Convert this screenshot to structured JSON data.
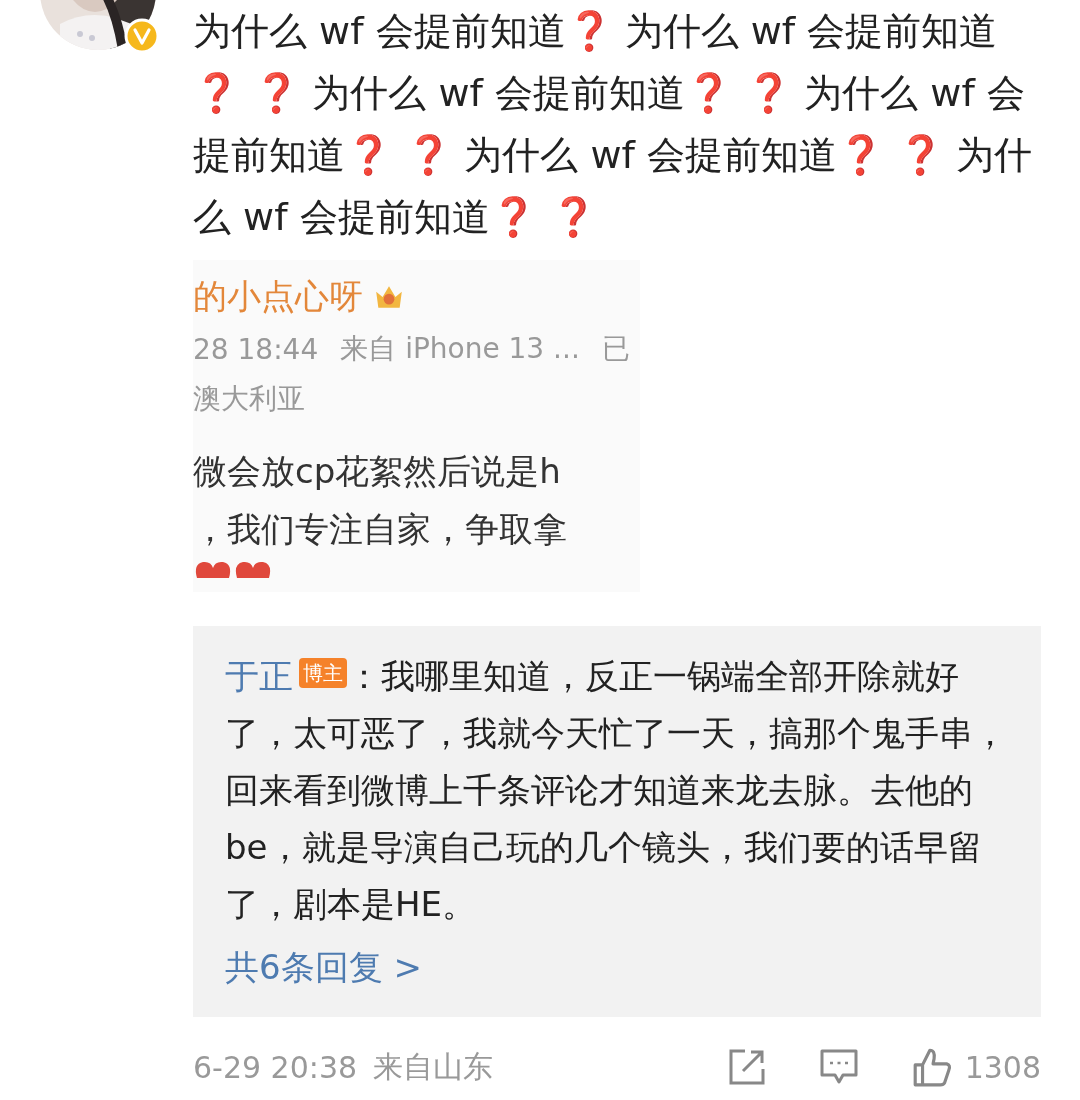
{
  "post": {
    "segments": [
      {
        "kind": "text",
        "text": "为什么 wf 会提前知道"
      },
      {
        "kind": "mark",
        "text": "❓"
      },
      {
        "kind": "text",
        "text": " 为什么 wf 会提前知道"
      },
      {
        "kind": "mark",
        "text": "❓ ❓"
      },
      {
        "kind": "text",
        "text": " 为什么 wf 会提前知道"
      },
      {
        "kind": "mark",
        "text": "❓ ❓"
      },
      {
        "kind": "text",
        "text": " 为什么 wf 会提前知道"
      },
      {
        "kind": "mark",
        "text": "❓ ❓"
      },
      {
        "kind": "text",
        "text": " 为什么 wf 会提前知道"
      },
      {
        "kind": "mark",
        "text": "❓ ❓"
      },
      {
        "kind": "text",
        "text": " 为什么 wf 会提前知道"
      },
      {
        "kind": "mark",
        "text": "❓ ❓"
      }
    ]
  },
  "quoted_screenshot": {
    "name": "的小点心呀",
    "time": "28 18:44",
    "source": "来自 iPhone 13 ...",
    "edited": "已",
    "location": "澳大利亚",
    "body_lines": [
      "微会放cp花絮然后说是h",
      "，我们专注自家，争取拿"
    ]
  },
  "reply": {
    "author": "于正",
    "badge": "博主",
    "text": "：我哪里知道，反正一锅端全部开除就好了，太可恶了，我就今天忙了一天，搞那个鬼手串，回来看到微博上千条评论才知道来龙去脉。去他的be，就是导演自己玩的几个镜头，我们要的话早留了，剧本是HE。",
    "more_link": "共6条回复 >"
  },
  "footer": {
    "time": "6-29 20:38",
    "location": "来自山东",
    "like_count": "1308"
  }
}
